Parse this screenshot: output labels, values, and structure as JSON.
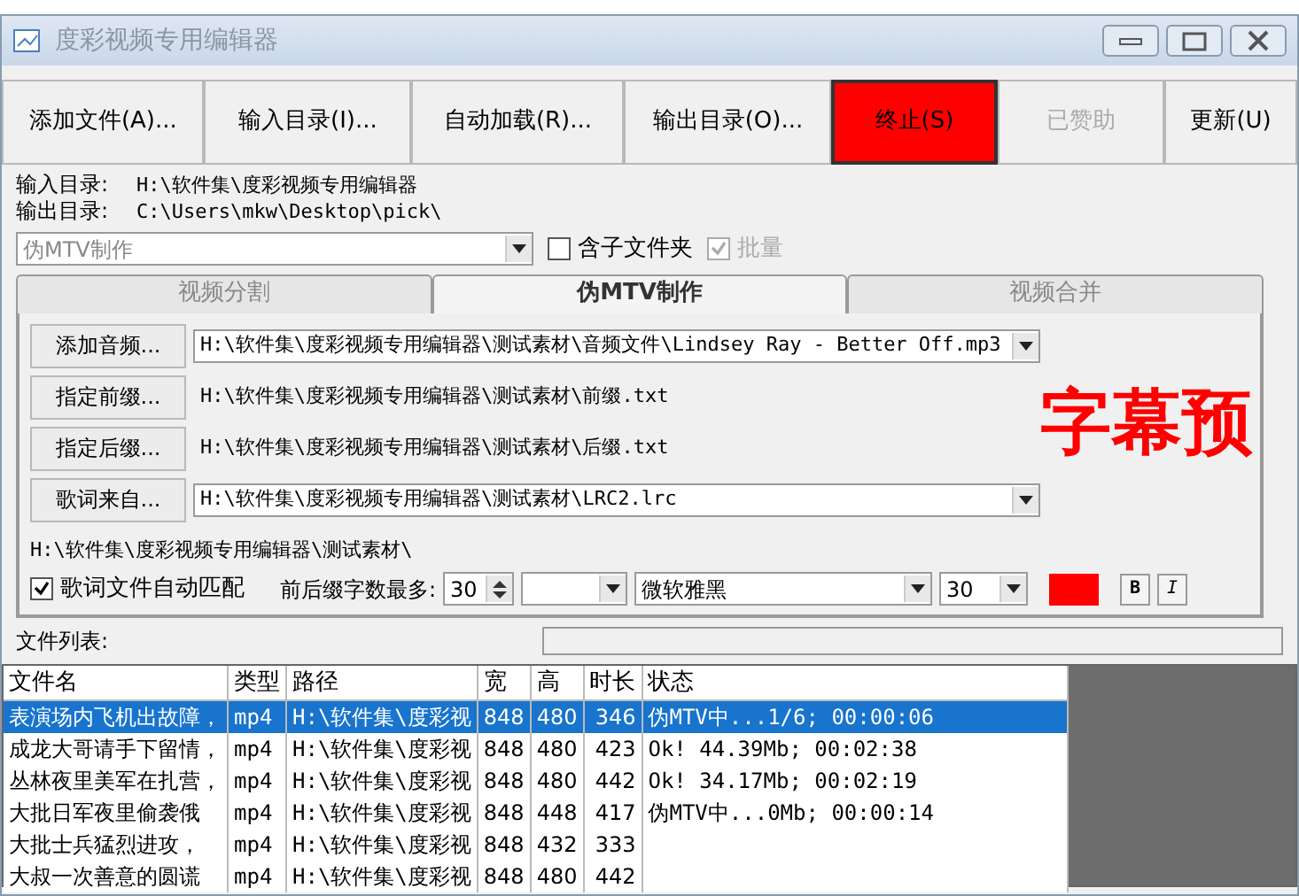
{
  "window": {
    "title": "度彩视频专用编辑器"
  },
  "toolbar": [
    {
      "label": "添加文件(A)...",
      "disabled": false,
      "highlighted": false
    },
    {
      "label": "输入目录(I)...",
      "disabled": false,
      "highlighted": false
    },
    {
      "label": "自动加载(R)...",
      "disabled": false,
      "highlighted": false
    },
    {
      "label": "输出目录(O)...",
      "disabled": false,
      "highlighted": false
    },
    {
      "label": "终止(S)",
      "disabled": false,
      "highlighted": true
    },
    {
      "label": "已赞助",
      "disabled": true,
      "highlighted": false
    },
    {
      "label": "更新(U)",
      "disabled": false,
      "highlighted": false
    }
  ],
  "directories": [
    {
      "label": "输入目录:",
      "value": "H:\\软件集\\度彩视频专用编辑器"
    },
    {
      "label": "输出目录:",
      "value": "C:\\Users\\mkw\\Desktop\\pick\\"
    }
  ],
  "mode_dropdown": {
    "value": "伪MTV制作"
  },
  "options": [
    {
      "label": "含子文件夹",
      "checked": false,
      "disabled": false
    },
    {
      "label": "批量",
      "checked": true,
      "disabled": true
    }
  ],
  "tabs": [
    {
      "label": "视频分割",
      "selected": false
    },
    {
      "label": "伪MTV制作",
      "selected": true
    },
    {
      "label": "视频合并",
      "selected": false
    }
  ],
  "mtv_panel": {
    "rows": [
      {
        "button": "添加音频...",
        "kind": "dropdown",
        "value": "H:\\软件集\\度彩视频专用编辑器\\测试素材\\音频文件\\Lindsey Ray - Better Off.mp3"
      },
      {
        "button": "指定前缀...",
        "kind": "text",
        "value": "H:\\软件集\\度彩视频专用编辑器\\测试素材\\前缀.txt"
      },
      {
        "button": "指定后缀...",
        "kind": "text",
        "value": "H:\\软件集\\度彩视频专用编辑器\\测试素材\\后缀.txt"
      },
      {
        "button": "歌词来自...",
        "kind": "dropdown",
        "value": "H:\\软件集\\度彩视频专用编辑器\\测试素材\\LRC2.lrc"
      }
    ],
    "preview_text": "字幕预",
    "lyrics_dir": "H:\\软件集\\度彩视频专用编辑器\\测试素材\\",
    "auto_match": {
      "label": "歌词文件自动匹配",
      "checked": true
    },
    "max_chars": {
      "label": "前后缀字数最多:",
      "value": "30"
    },
    "font": "微软雅黑",
    "font_size": "30",
    "color_swatch": {
      "color": "#ff0000"
    },
    "bold_label": "B",
    "italic_label": "I"
  },
  "file_list": {
    "label": "文件列表:",
    "columns": [
      "文件名",
      "类型",
      "路径",
      "宽",
      "高",
      "时长",
      "状态"
    ],
    "rows": [
      {
        "selected": true,
        "cells": [
          "表演场内飞机出故障，",
          "mp4",
          "H:\\软件集\\度彩视",
          "848",
          "480",
          "346",
          "伪MTV中...1/6; 00:00:06"
        ]
      },
      {
        "selected": false,
        "cells": [
          "成龙大哥请手下留情，",
          "mp4",
          "H:\\软件集\\度彩视",
          "848",
          "480",
          "423",
          "Ok! 44.39Mb; 00:02:38"
        ]
      },
      {
        "selected": false,
        "cells": [
          "丛林夜里美军在扎营，",
          "mp4",
          "H:\\软件集\\度彩视",
          "848",
          "480",
          "442",
          "Ok! 34.17Mb; 00:02:19"
        ]
      },
      {
        "selected": false,
        "cells": [
          "大批日军夜里偷袭俄",
          "mp4",
          "H:\\软件集\\度彩视",
          "848",
          "448",
          "417",
          "伪MTV中...0Mb; 00:00:14"
        ]
      },
      {
        "selected": false,
        "cells": [
          "大批士兵猛烈进攻，",
          "mp4",
          "H:\\软件集\\度彩视",
          "848",
          "432",
          "333",
          ""
        ]
      },
      {
        "selected": false,
        "cells": [
          "大叔一次善意的圆谎",
          "mp4",
          "H:\\软件集\\度彩视",
          "848",
          "480",
          "442",
          ""
        ]
      }
    ]
  }
}
